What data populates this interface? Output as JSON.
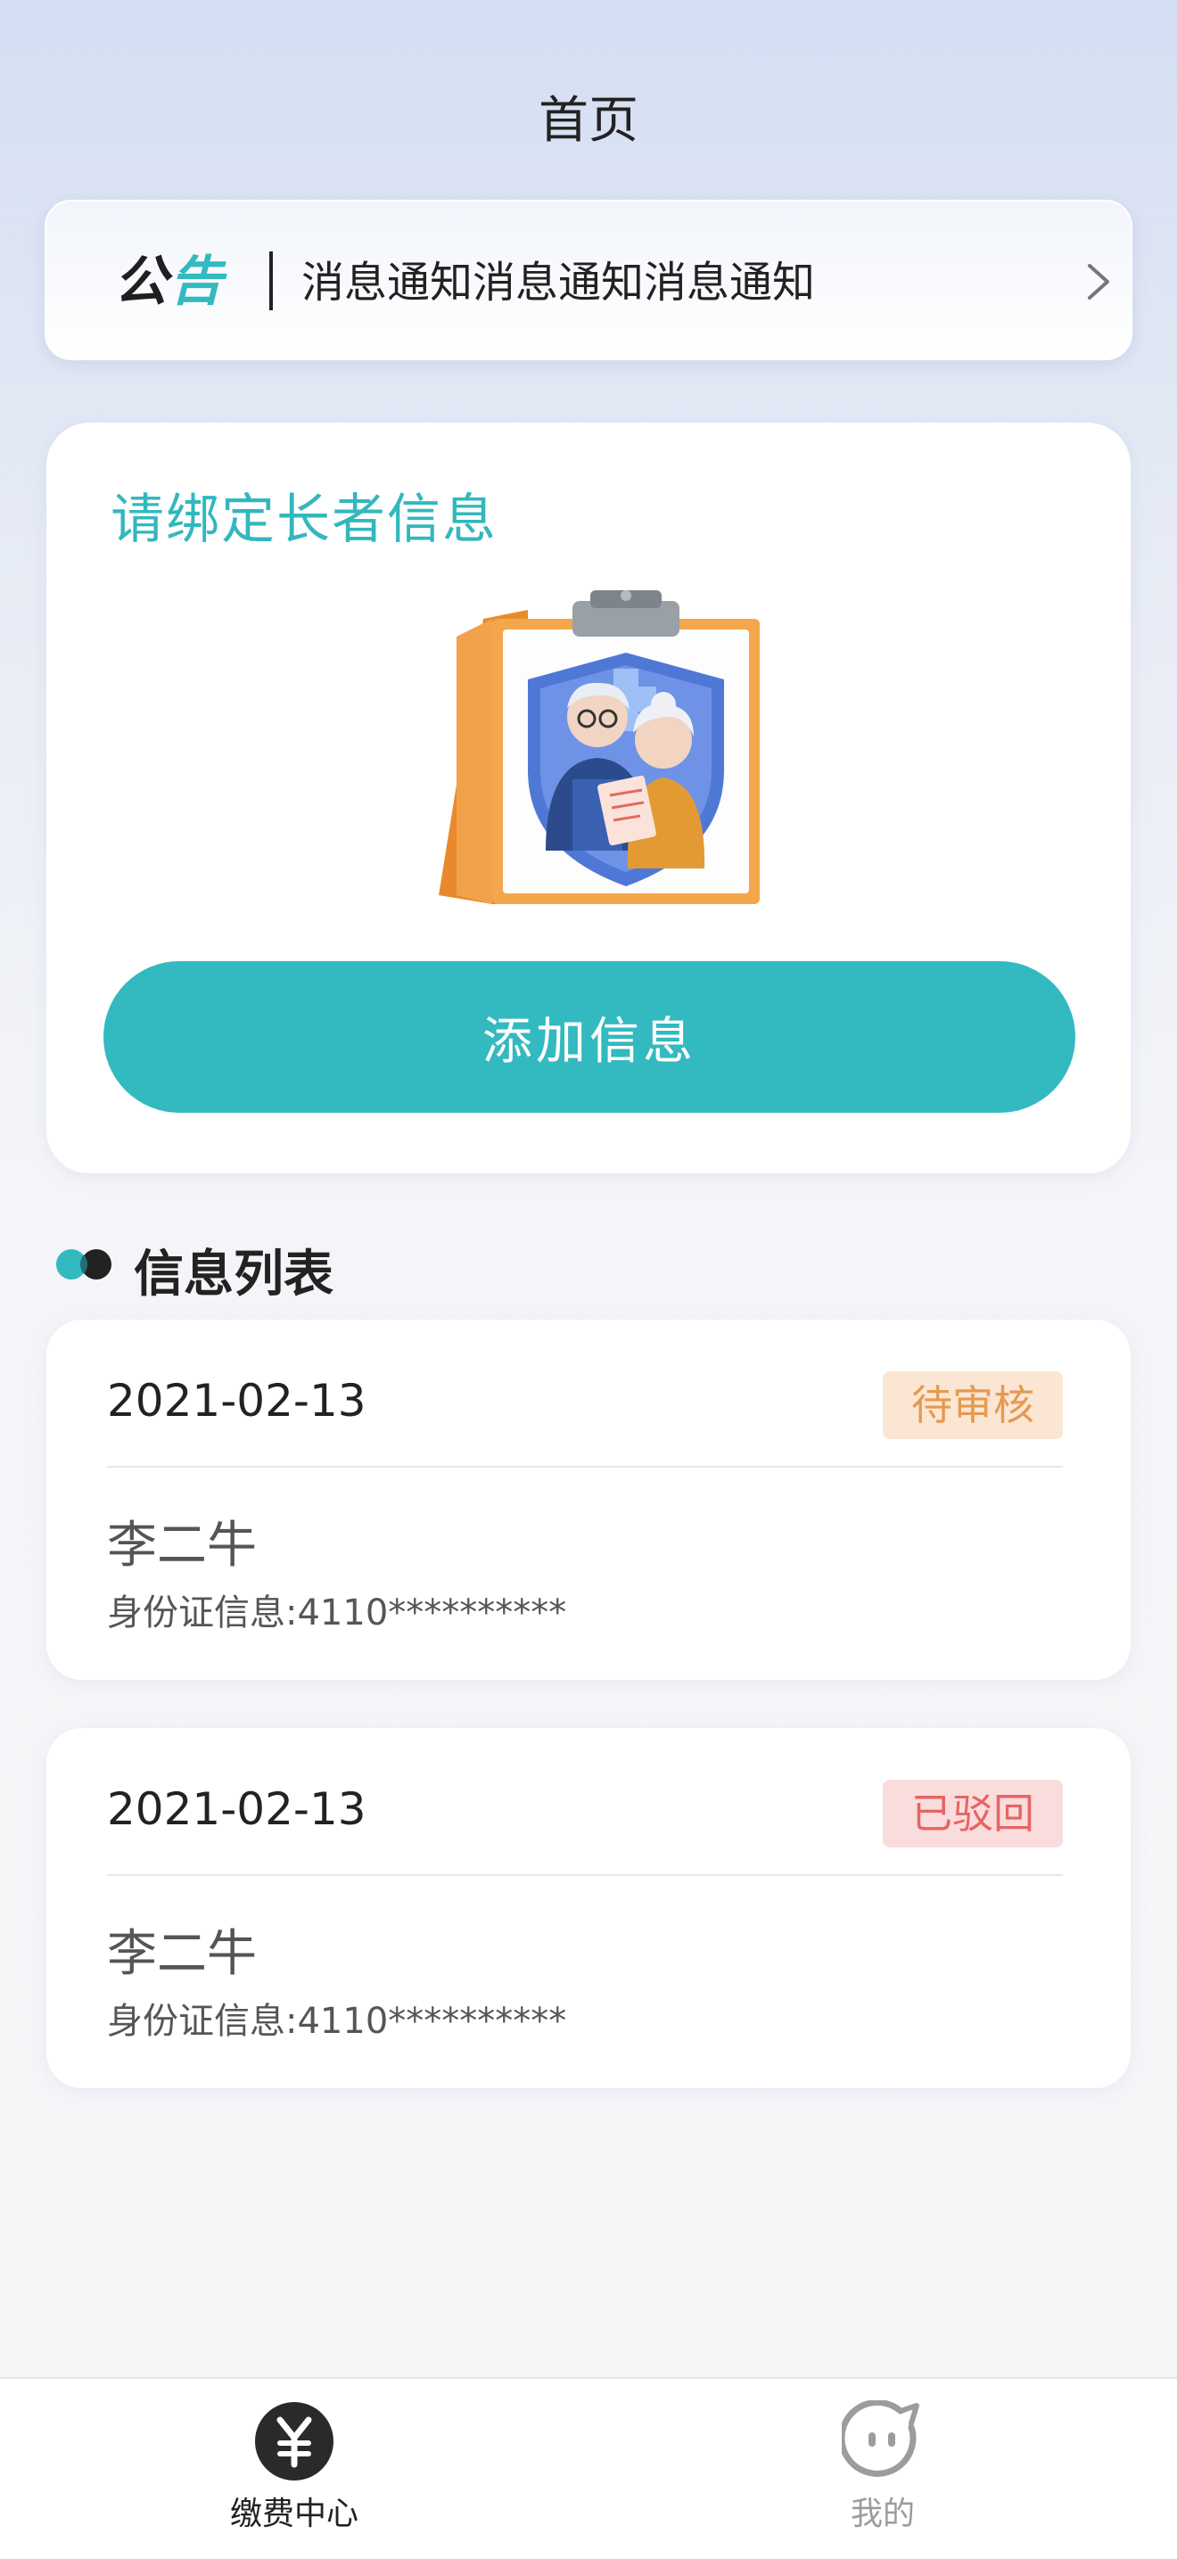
{
  "nav": {
    "title": "首页"
  },
  "notice": {
    "badge_a": "公",
    "badge_b": "告",
    "text": "消息通知消息通知消息通知",
    "arrow_icon": "chevron-right-icon"
  },
  "bind_card": {
    "title": "请绑定长者信息",
    "illustration": "elderly-couple-clipboard-illustration",
    "button_label": "添加信息"
  },
  "section": {
    "title": "信息列表"
  },
  "records": [
    {
      "date": "2021-02-13",
      "status": "待审核",
      "name": "李二牛",
      "id_info": "身份证信息:4110**********"
    },
    {
      "date": "2021-02-13",
      "status": "已驳回",
      "name": "李二牛",
      "id_info": "身份证信息:4110**********"
    }
  ],
  "tabbar": {
    "tabs": [
      {
        "label": "缴费中心",
        "icon": "yuan-coin-icon",
        "active": true
      },
      {
        "label": "我的",
        "icon": "face-icon",
        "active": false
      }
    ]
  },
  "colors": {
    "accent": "#33b9c0",
    "pending_text": "#e59a4e",
    "pending_bg": "#fbe6d4",
    "rejected_text": "#e56565",
    "rejected_bg": "#fbdcdc"
  }
}
